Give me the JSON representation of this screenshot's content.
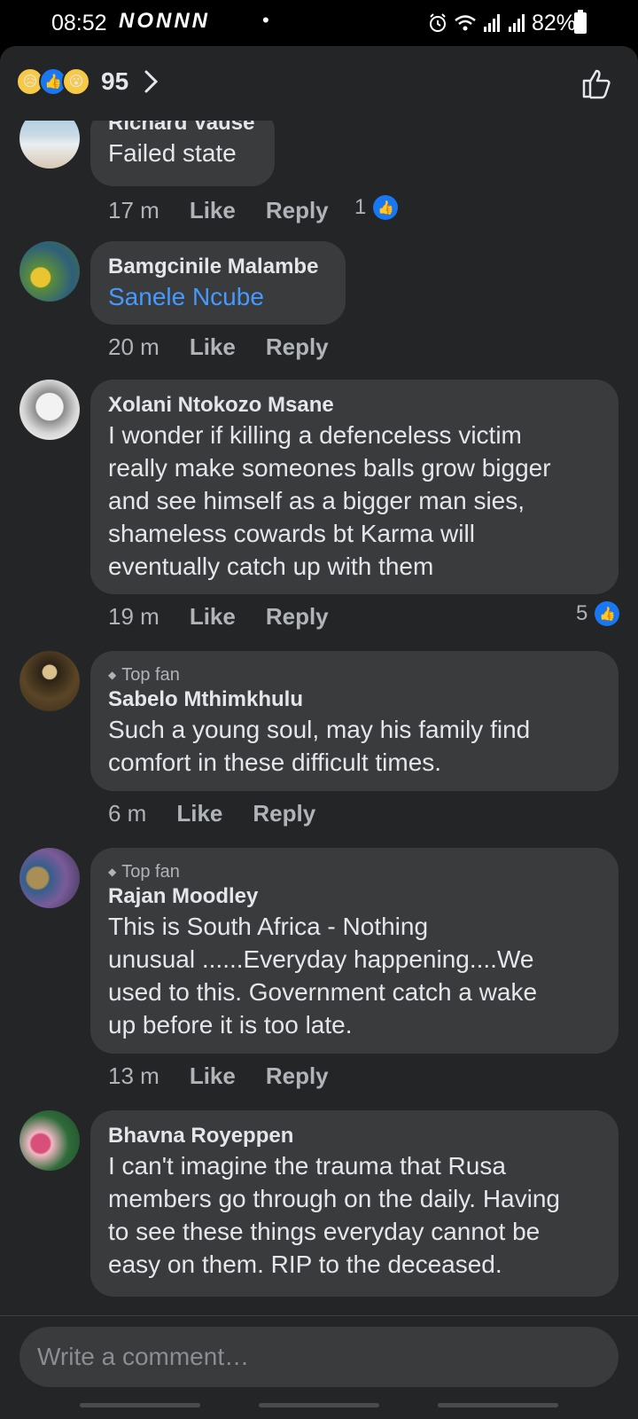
{
  "status_bar": {
    "time": "08:52",
    "notifications": "NONNN",
    "dot": "•",
    "battery": "82%"
  },
  "header": {
    "reaction_count": "95",
    "reactions": [
      "sad",
      "like",
      "wow"
    ]
  },
  "comments": [
    {
      "name": "Richard Vause",
      "text": "Failed state",
      "time": "17 m",
      "like": "Like",
      "reply": "Reply",
      "likes": "1"
    },
    {
      "name": "Bamgcinile Malambe",
      "text": "Sanele Ncube",
      "time": "20 m",
      "like": "Like",
      "reply": "Reply"
    },
    {
      "name": "Xolani Ntokozo Msane",
      "text_lines": [
        "I wonder if killing a defenceless victim",
        "really make someones balls grow bigger",
        "and see himself as a bigger man sies,",
        "shameless cowards bt Karma will",
        "eventually catch up with them"
      ],
      "time": "19 m",
      "like": "Like",
      "reply": "Reply",
      "likes": "5"
    },
    {
      "badge": "Top fan",
      "name": "Sabelo Mthimkhulu",
      "text_lines": [
        "Such a young soul, may his family find",
        "comfort in these difficult times."
      ],
      "time": "6 m",
      "like": "Like",
      "reply": "Reply"
    },
    {
      "badge": "Top fan",
      "name": "Rajan Moodley",
      "text_lines": [
        "This is South Africa - Nothing",
        "unusual ......Everyday happening....We",
        "used to this.  Government catch a wake",
        "up before it is too late."
      ],
      "time": "13 m",
      "like": "Like",
      "reply": "Reply"
    },
    {
      "name": "Bhavna Royeppen",
      "text_lines": [
        "I can't imagine the trauma that Rusa",
        "members go through on the daily. Having",
        "to see these things everyday cannot be",
        "easy on them. RIP to the deceased."
      ]
    }
  ],
  "composer": {
    "placeholder": "Write a comment…"
  },
  "colors": {
    "background": "#242526",
    "bubble": "#3a3b3c",
    "link": "#4599ff",
    "like_blue": "#1877f2"
  }
}
